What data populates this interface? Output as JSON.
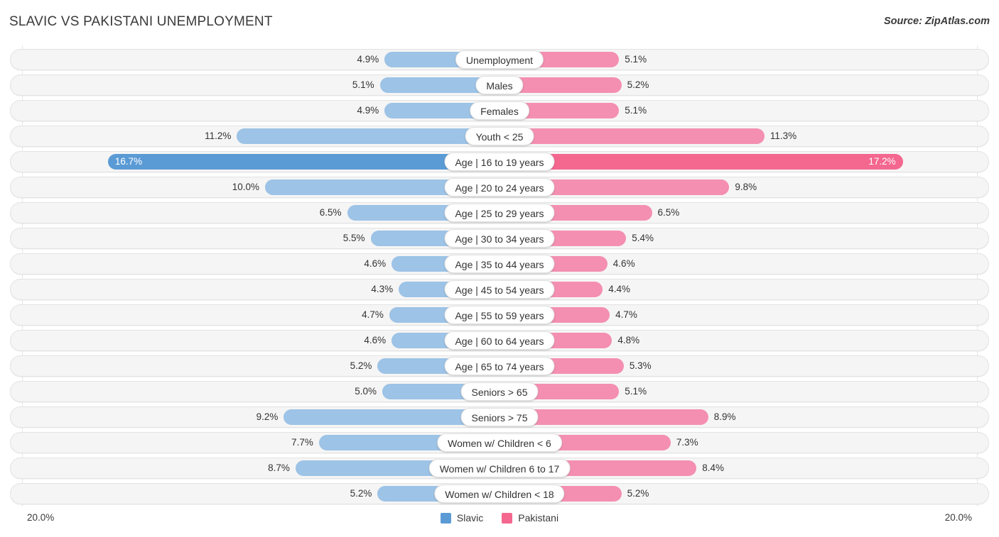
{
  "header": {
    "title": "SLAVIC VS PAKISTANI UNEMPLOYMENT",
    "source": "Source: ZipAtlas.com"
  },
  "axis": {
    "left_label": "20.0%",
    "right_label": "20.0%"
  },
  "legend": {
    "items": [
      {
        "label": "Slavic",
        "color": "#5b9bd5"
      },
      {
        "label": "Pakistani",
        "color": "#f4678f"
      }
    ]
  },
  "colors": {
    "left_normal": "#9dc3e6",
    "left_highlight": "#5b9bd5",
    "right_normal": "#f48fb1",
    "right_highlight": "#f4678f",
    "track": "#f5f5f5"
  },
  "chart_data": {
    "type": "bar",
    "title": "SLAVIC VS PAKISTANI UNEMPLOYMENT",
    "xlabel": "",
    "ylabel": "",
    "orientation": "horizontal-diverging",
    "axis_max": 20.0,
    "grid": false,
    "legend_position": "bottom-center",
    "categories": [
      "Unemployment",
      "Males",
      "Females",
      "Youth < 25",
      "Age | 16 to 19 years",
      "Age | 20 to 24 years",
      "Age | 25 to 29 years",
      "Age | 30 to 34 years",
      "Age | 35 to 44 years",
      "Age | 45 to 54 years",
      "Age | 55 to 59 years",
      "Age | 60 to 64 years",
      "Age | 65 to 74 years",
      "Seniors > 65",
      "Seniors > 75",
      "Women w/ Children < 6",
      "Women w/ Children 6 to 17",
      "Women w/ Children < 18"
    ],
    "series": [
      {
        "name": "Slavic",
        "side": "left",
        "values": [
          4.9,
          5.1,
          4.9,
          11.2,
          16.7,
          10.0,
          6.5,
          5.5,
          4.6,
          4.3,
          4.7,
          4.6,
          5.2,
          5.0,
          9.2,
          7.7,
          8.7,
          5.2
        ],
        "labels": [
          "4.9%",
          "5.1%",
          "4.9%",
          "11.2%",
          "16.7%",
          "10.0%",
          "6.5%",
          "5.5%",
          "4.6%",
          "4.3%",
          "4.7%",
          "4.6%",
          "5.2%",
          "5.0%",
          "9.2%",
          "7.7%",
          "8.7%",
          "5.2%"
        ]
      },
      {
        "name": "Pakistani",
        "side": "right",
        "values": [
          5.1,
          5.2,
          5.1,
          11.3,
          17.2,
          9.8,
          6.5,
          5.4,
          4.6,
          4.4,
          4.7,
          4.8,
          5.3,
          5.1,
          8.9,
          7.3,
          8.4,
          5.2
        ],
        "labels": [
          "5.1%",
          "5.2%",
          "5.1%",
          "11.3%",
          "17.2%",
          "9.8%",
          "6.5%",
          "5.4%",
          "4.6%",
          "4.4%",
          "4.7%",
          "4.8%",
          "5.3%",
          "5.1%",
          "8.9%",
          "7.3%",
          "8.4%",
          "5.2%"
        ]
      }
    ],
    "highlighted_index": 4
  }
}
